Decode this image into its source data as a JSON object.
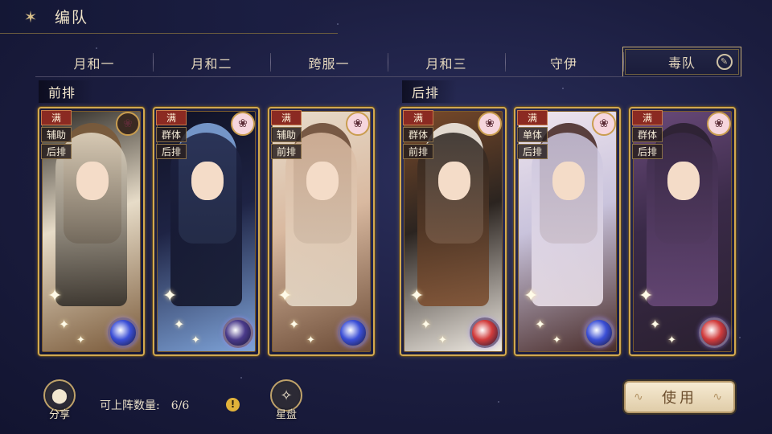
{
  "header": {
    "title": "编队",
    "back_icon": "cloud-back-icon"
  },
  "tabs": [
    {
      "label": "月和一",
      "active": false
    },
    {
      "label": "月和二",
      "active": false
    },
    {
      "label": "跨服一",
      "active": false
    },
    {
      "label": "月和三",
      "active": false
    },
    {
      "label": "守伊",
      "active": false
    },
    {
      "label": "毒队",
      "active": true
    }
  ],
  "sections": {
    "front": "前排",
    "back": "后排"
  },
  "cards": [
    {
      "full": "满",
      "role": "辅助",
      "row": "后排",
      "emblem": "portrait-emblem",
      "palette": [
        "#e7dcc8",
        "#7a5a3a",
        "#2d2a26"
      ],
      "orb": "#3b4fd6"
    },
    {
      "full": "满",
      "role": "群体",
      "row": "后排",
      "emblem": "pig-emblem",
      "palette": [
        "#1e2344",
        "#7ea3d8",
        "#101225"
      ],
      "orb": "#4a3a8a"
    },
    {
      "full": "满",
      "role": "辅助",
      "row": "前排",
      "emblem": "pig-emblem",
      "palette": [
        "#d9b9a0",
        "#6b4b36",
        "#e8dccb"
      ],
      "orb": "#3b4fd6"
    },
    {
      "full": "满",
      "role": "群体",
      "row": "前排",
      "emblem": "pig-emblem",
      "palette": [
        "#2b2420",
        "#efeae2",
        "#7a4a2a"
      ],
      "orb": "#d13c3c"
    },
    {
      "full": "满",
      "role": "单体",
      "row": "后排",
      "emblem": "pig-emblem",
      "palette": [
        "#c9c3dc",
        "#4a2d2a",
        "#efe5ee"
      ],
      "orb": "#3b4fd6"
    },
    {
      "full": "满",
      "role": "群体",
      "row": "后排",
      "emblem": "pig-emblem",
      "palette": [
        "#3a2a48",
        "#2a2030",
        "#6a4a7a"
      ],
      "orb": "#d13c3c"
    }
  ],
  "footer": {
    "share_label": "分享",
    "capacity_label": "可上阵数量:",
    "capacity_value": "6/6",
    "info_glyph": "!",
    "star_label": "星盘",
    "use_label": "使用"
  }
}
